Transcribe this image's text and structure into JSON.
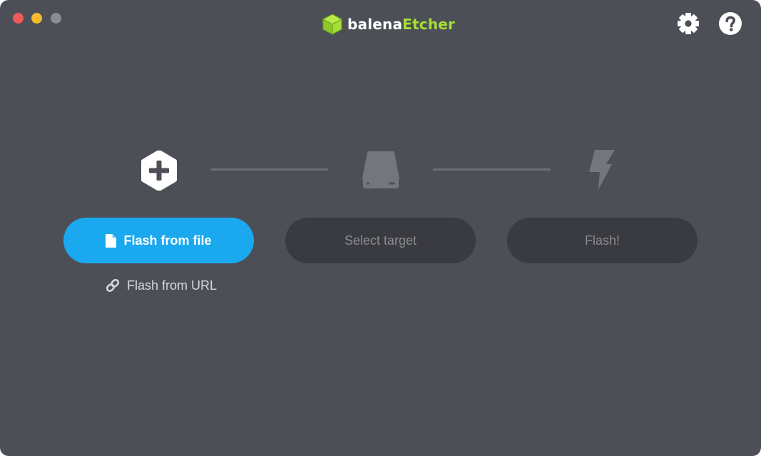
{
  "window": {
    "traffic_lights": [
      "close",
      "minimize",
      "zoom"
    ]
  },
  "logo": {
    "part1": "balena",
    "part2": "Etcher",
    "accent_color": "#a5de37"
  },
  "toolbar": {
    "settings_icon": "gear-icon",
    "help_icon": "question-mark-icon"
  },
  "steps": {
    "source_icon": "plus-hexagon-icon",
    "target_icon": "drive-icon",
    "flash_icon": "lightning-bolt-icon"
  },
  "buttons": {
    "flash_from_file": "Flash from file",
    "select_target": "Select target",
    "flash": "Flash!"
  },
  "links": {
    "flash_from_url": "Flash from URL"
  },
  "colors": {
    "background": "#4d4f57",
    "primary": "#1aa9ef",
    "disabled_button": "#3a3b41"
  }
}
